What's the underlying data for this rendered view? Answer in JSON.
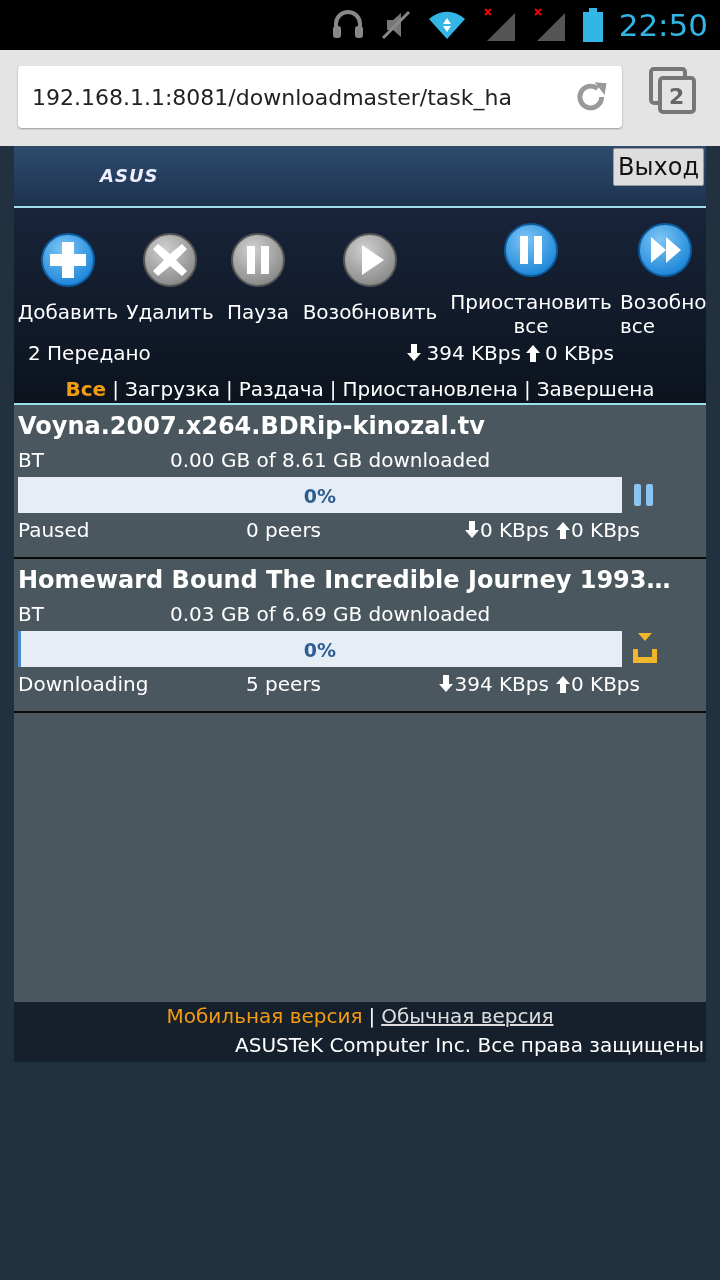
{
  "status_bar": {
    "time": "22:50"
  },
  "browser": {
    "url": "192.168.1.1:8081/downloadmaster/task_ha",
    "tab_count": "2"
  },
  "header": {
    "logo": "ASUS",
    "logout": "Выход"
  },
  "actions": [
    {
      "label": "Добавить",
      "kind": "add"
    },
    {
      "label": "Удалить",
      "kind": "delete"
    },
    {
      "label": "Пауза",
      "kind": "pause"
    },
    {
      "label": "Возобновить",
      "kind": "resume"
    },
    {
      "label": "Приостановить все",
      "kind": "pause_all"
    },
    {
      "label": "Возобно все",
      "kind": "resume_all"
    }
  ],
  "summary": {
    "transferred": "2 Передано",
    "down": "394 KBps",
    "up": "0 KBps"
  },
  "filters": [
    {
      "label": "Все",
      "selected": true
    },
    {
      "prefix": "|",
      "label": "Загрузка",
      "selected": false
    },
    {
      "prefix": "|",
      "label": "Раздача",
      "selected": false
    },
    {
      "prefix": "|",
      "label": "Приостановлена",
      "selected": false
    },
    {
      "prefix": "|",
      "label": "Завершена",
      "selected": false
    }
  ],
  "tasks": [
    {
      "name": "Voyna.2007.x264.BDRip-kinozal.tv",
      "type": "BT",
      "size": "0.00 GB of 8.61 GB downloaded",
      "level": 0,
      "percent": "0%",
      "kind": "paused",
      "status": "Paused",
      "peers": "0 peers",
      "down": "0 KBps",
      "up": "0 KBps"
    },
    {
      "name": "Homeward Bound The Incredible Journey 1993…",
      "type": "BT",
      "size": "0.03 GB of 6.69 GB downloaded",
      "level": 0.005,
      "percent": "0%",
      "kind": "downloading",
      "status": "Downloading",
      "peers": "5 peers",
      "down": "394 KBps",
      "up": "0 KBps"
    }
  ],
  "footer": {
    "links": [
      {
        "label": "Мобильная версия",
        "selected": true
      },
      {
        "prefix": "|",
        "label": "Обычная версия",
        "selected": false
      }
    ],
    "copyright": "ASUSTeK Computer Inc. Все права защищены"
  }
}
